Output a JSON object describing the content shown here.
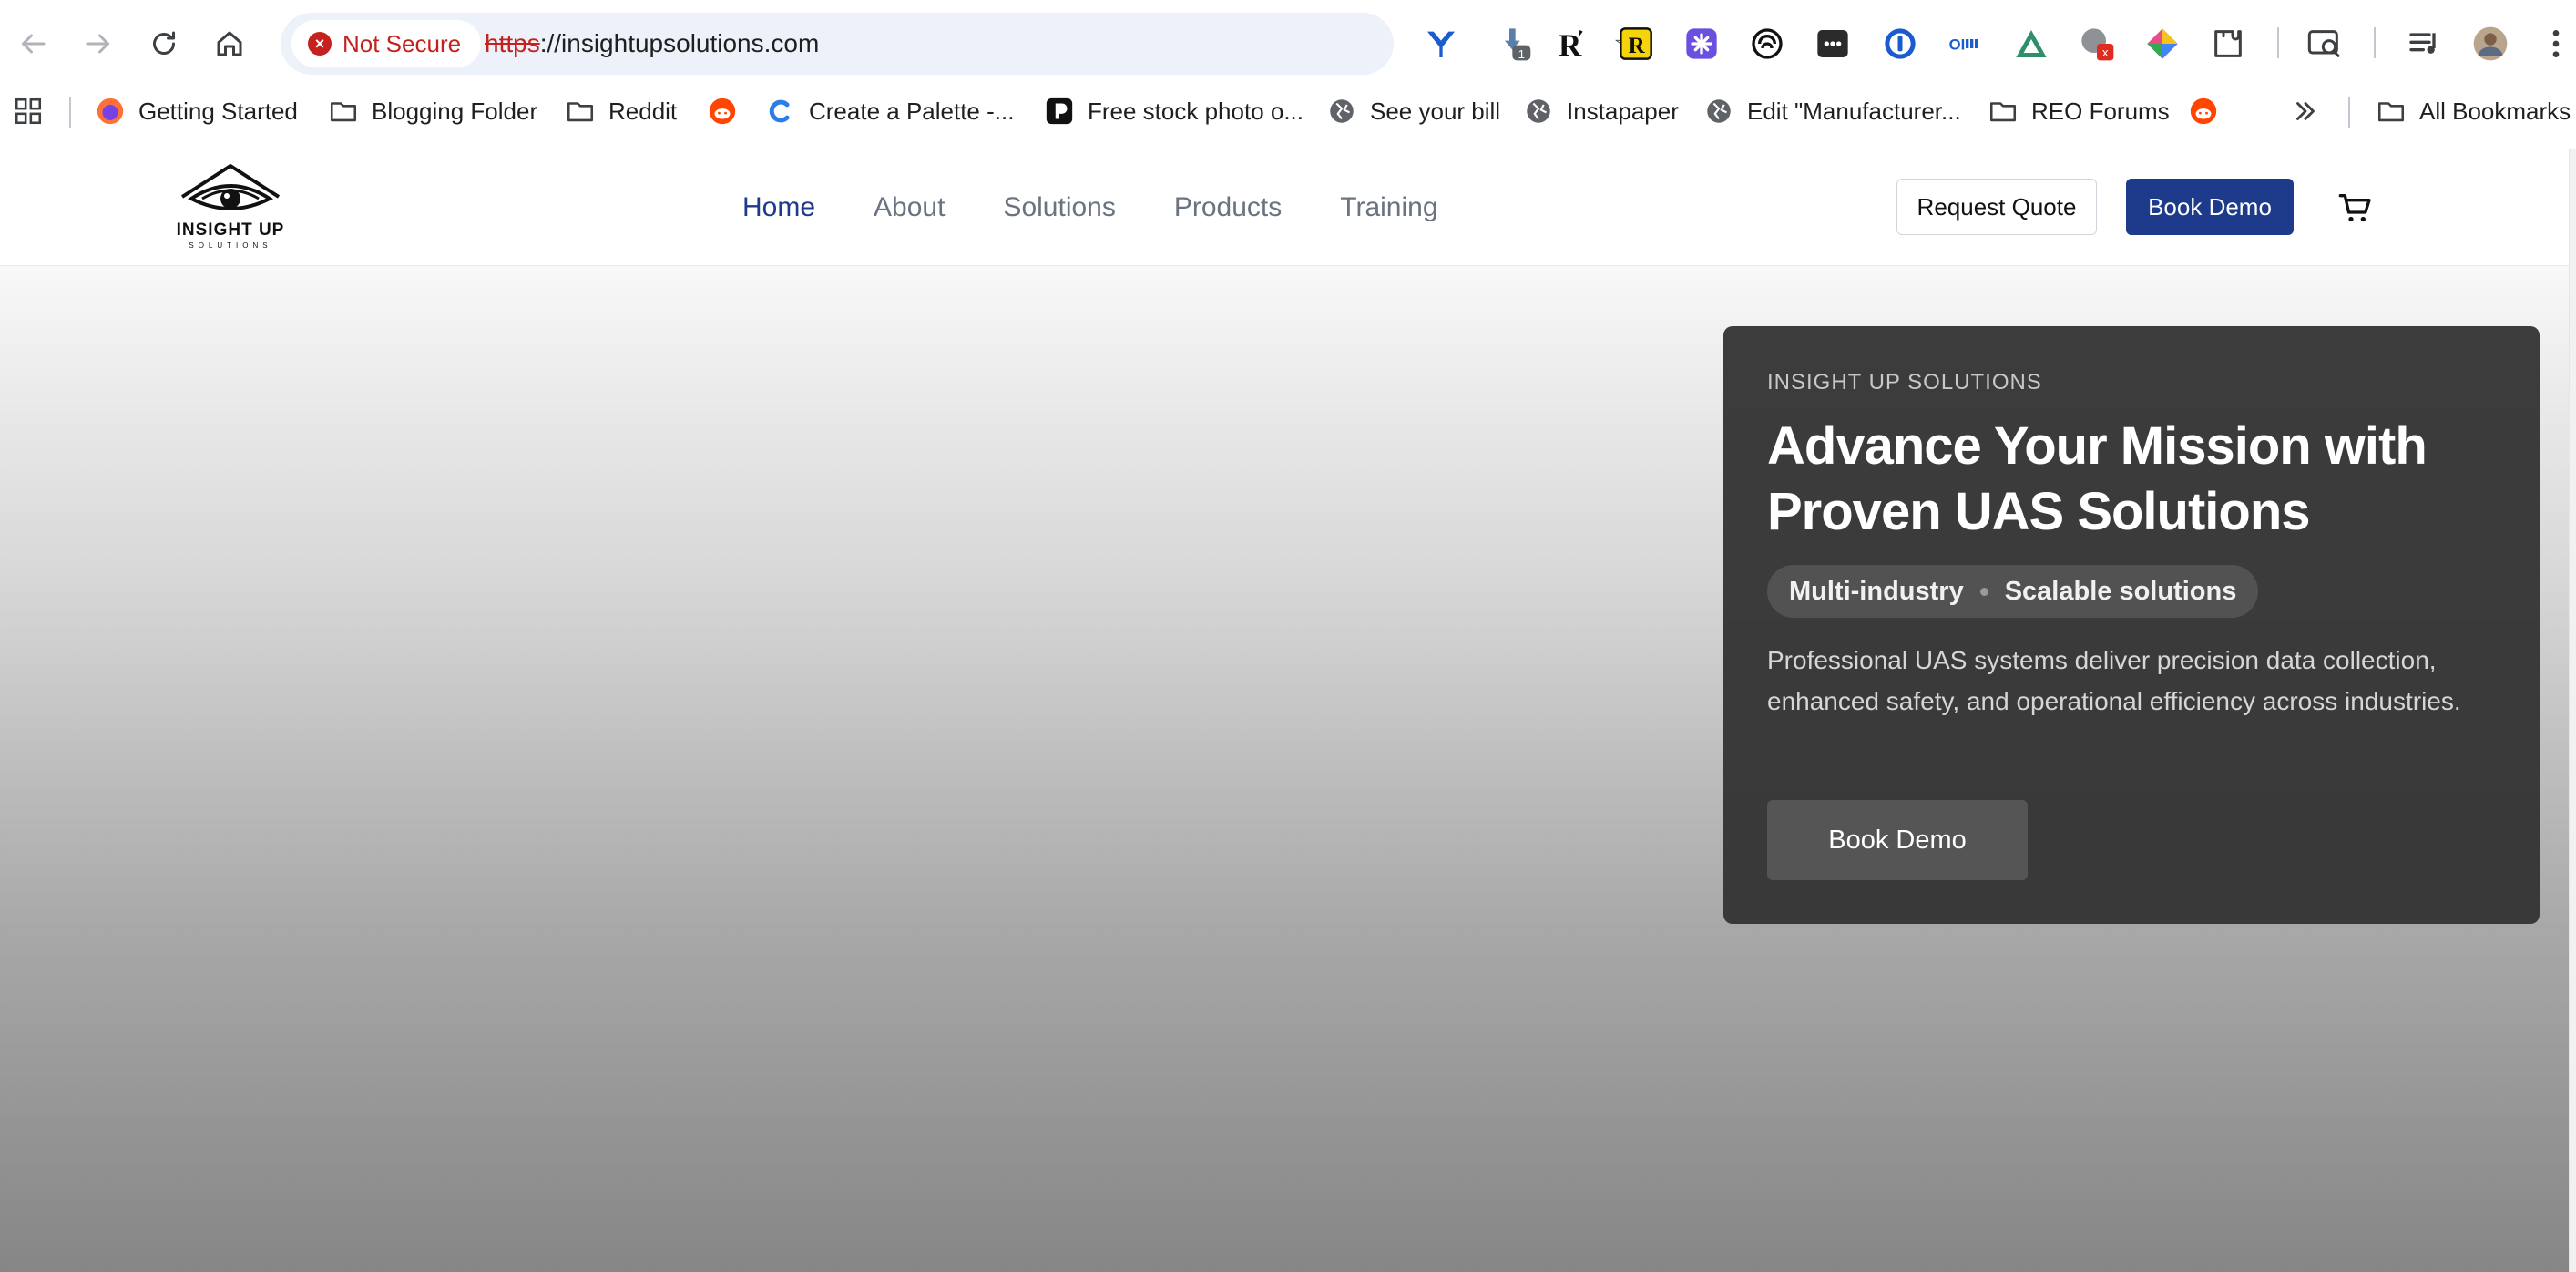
{
  "browser": {
    "security_label": "Not Secure",
    "url_scheme": "https",
    "url_rest": "://insightupsolutions.com",
    "extension_badges": [
      "1"
    ],
    "bookmarks": [
      {
        "label": "Getting Started",
        "icon": "firefox-icon"
      },
      {
        "label": "Blogging Folder",
        "icon": "folder-icon"
      },
      {
        "label": "Reddit",
        "icon": "folder-icon"
      },
      {
        "label": "",
        "icon": "reddit-icon"
      },
      {
        "label": "Create a Palette -...",
        "icon": "coolors-icon"
      },
      {
        "label": "Free stock photo o...",
        "icon": "pexels-icon"
      },
      {
        "label": "See your bill",
        "icon": "globe-icon"
      },
      {
        "label": "Instapaper",
        "icon": "globe-icon"
      },
      {
        "label": "Edit \"Manufacturer...",
        "icon": "globe-icon"
      },
      {
        "label": "REO Forums",
        "icon": "folder-icon"
      },
      {
        "label": "",
        "icon": "reddit-icon"
      }
    ],
    "all_bookmarks_label": "All Bookmarks"
  },
  "site": {
    "logo": {
      "wordmark": "INSIGHT UP",
      "sub": "SOLUTIONS"
    },
    "nav": [
      {
        "label": "Home",
        "active": true
      },
      {
        "label": "About",
        "active": false
      },
      {
        "label": "Solutions",
        "active": false
      },
      {
        "label": "Products",
        "active": false
      },
      {
        "label": "Training",
        "active": false
      }
    ],
    "request_quote_label": "Request Quote",
    "book_demo_label": "Book Demo"
  },
  "hero": {
    "eyebrow": "INSIGHT UP SOLUTIONS",
    "headline": "Advance Your Mission with Proven UAS Solutions",
    "tags": [
      "Multi-industry",
      "Scalable solutions"
    ],
    "description": "Professional UAS systems deliver precision data collection, enhanced safety, and operational efficiency across industries.",
    "cta_label": "Book Demo"
  },
  "colors": {
    "brand_primary": "#1e3a8a",
    "not_secure": "#c5221f",
    "hero_card": "#343434"
  }
}
